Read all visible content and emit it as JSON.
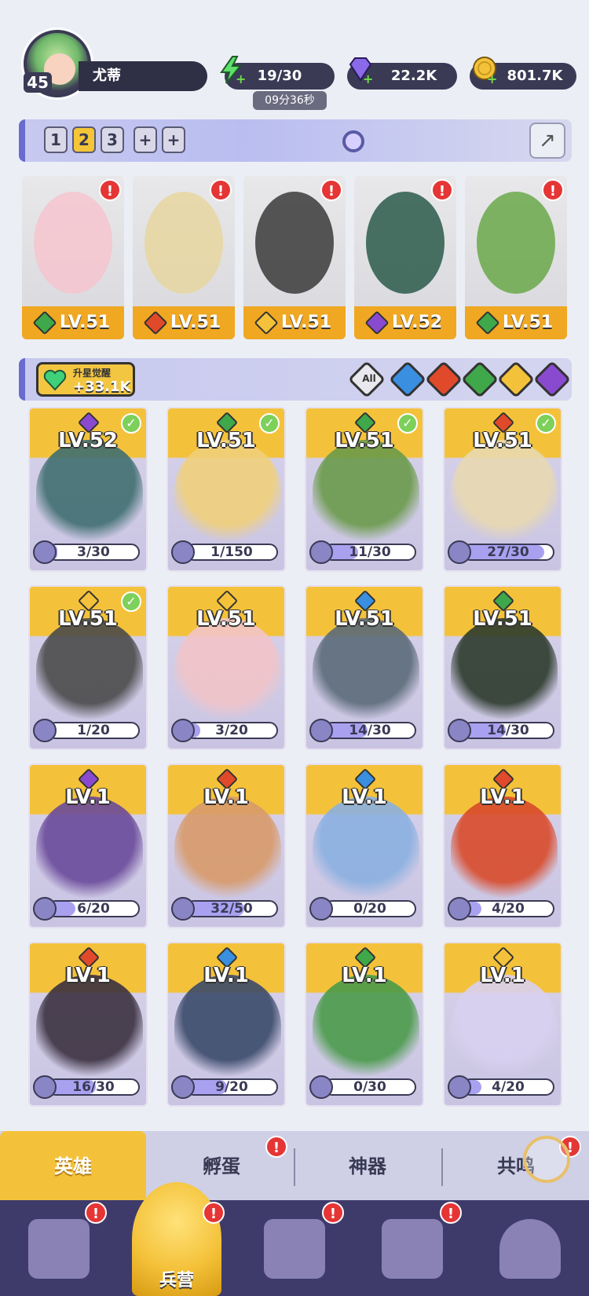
{
  "player": {
    "level": "45",
    "name": "尤蒂"
  },
  "resources": {
    "energy": "19/30",
    "energy_timer": "09分36秒",
    "gems": "22.2K",
    "coins": "801.7K"
  },
  "team_tabs": [
    "1",
    "2",
    "3",
    "+",
    "+"
  ],
  "team": [
    {
      "level": "LV.51",
      "element_color": "#3fa84a"
    },
    {
      "level": "LV.51",
      "element_color": "#e04a2a"
    },
    {
      "level": "LV.51",
      "element_color": "#f4c23a"
    },
    {
      "level": "LV.52",
      "element_color": "#8a4ad0"
    },
    {
      "level": "LV.51",
      "element_color": "#3fa84a"
    }
  ],
  "awaken": {
    "label": "升星觉醒",
    "value": "+33.1K"
  },
  "filters": {
    "all_label": "All",
    "colors": [
      "#3a8fe0",
      "#e04a2a",
      "#3fa84a",
      "#f4c23a",
      "#8a4ad0"
    ]
  },
  "heroes": [
    {
      "level": "LV.52",
      "progress": "3/30",
      "fill": 0.1,
      "element_color": "#8a4ad0",
      "checked": true,
      "art": "#3f6e70"
    },
    {
      "level": "LV.51",
      "progress": "1/150",
      "fill": 0.01,
      "element_color": "#3fa84a",
      "checked": true,
      "art": "#f0d07a"
    },
    {
      "level": "LV.51",
      "progress": "11/30",
      "fill": 0.37,
      "element_color": "#3fa84a",
      "checked": true,
      "art": "#6a9a4a"
    },
    {
      "level": "LV.51",
      "progress": "27/30",
      "fill": 0.9,
      "element_color": "#e04a2a",
      "checked": true,
      "art": "#e8d9b0"
    },
    {
      "level": "LV.51",
      "progress": "1/20",
      "fill": 0.05,
      "element_color": "#f4c23a",
      "checked": true,
      "art": "#4a4a4a"
    },
    {
      "level": "LV.51",
      "progress": "3/20",
      "fill": 0.15,
      "element_color": "#f4c23a",
      "checked": false,
      "art": "#f2c4c8"
    },
    {
      "level": "LV.51",
      "progress": "14/30",
      "fill": 0.47,
      "element_color": "#3a8fe0",
      "checked": false,
      "art": "#5a6a78"
    },
    {
      "level": "LV.51",
      "progress": "14/30",
      "fill": 0.47,
      "element_color": "#3fa84a",
      "checked": false,
      "art": "#2c3a2c"
    },
    {
      "level": "LV.1",
      "progress": "6/20",
      "fill": 0.3,
      "element_color": "#8a4ad0",
      "checked": false,
      "art": "#6a4a9a"
    },
    {
      "level": "LV.1",
      "progress": "32/50",
      "fill": 0.64,
      "element_color": "#e04a2a",
      "checked": false,
      "art": "#d89a6a"
    },
    {
      "level": "LV.1",
      "progress": "0/20",
      "fill": 0.0,
      "element_color": "#3a8fe0",
      "checked": false,
      "art": "#8ab0e0"
    },
    {
      "level": "LV.1",
      "progress": "4/20",
      "fill": 0.2,
      "element_color": "#e04a2a",
      "checked": false,
      "art": "#d84a2a"
    },
    {
      "level": "LV.1",
      "progress": "16/30",
      "fill": 0.53,
      "element_color": "#e04a2a",
      "checked": false,
      "art": "#3a3040"
    },
    {
      "level": "LV.1",
      "progress": "9/20",
      "fill": 0.45,
      "element_color": "#3a8fe0",
      "checked": false,
      "art": "#3a4a6a"
    },
    {
      "level": "LV.1",
      "progress": "0/30",
      "fill": 0.0,
      "element_color": "#3fa84a",
      "checked": false,
      "art": "#4a9a4a"
    },
    {
      "level": "LV.1",
      "progress": "4/20",
      "fill": 0.2,
      "element_color": "#f4c23a",
      "checked": false,
      "art": "#d8d0f0"
    }
  ],
  "tabs": {
    "heroes": "英雄",
    "hatch": "孵蛋",
    "artifact": "神器",
    "resonance": "共鸣"
  },
  "nav": {
    "barracks": "兵营"
  }
}
